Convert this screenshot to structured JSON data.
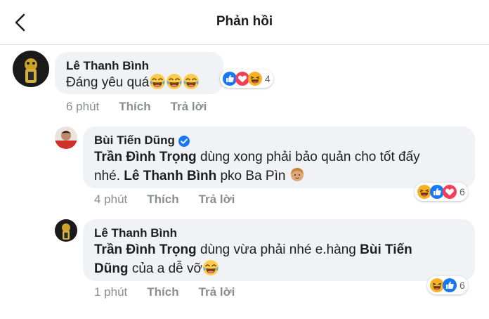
{
  "header": {
    "title": "Phản hồi"
  },
  "comments": [
    {
      "author": "Lê Thanh Bình",
      "text": "Đáng yêu quá",
      "time": "6 phút",
      "like_label": "Thích",
      "reply_label": "Trả lời",
      "reaction_count": "4",
      "reactions": [
        "like-icon",
        "love-icon",
        "haha-icon"
      ],
      "inline_emoji": [
        "laughing-emoji-icon",
        "laughing-emoji-icon",
        "laughing-emoji-icon"
      ]
    },
    {
      "author": "Bùi Tiến Dũng",
      "verified": true,
      "mention1": "Trần Đình Trọng",
      "text_part1": " dùng xong phải bảo quản cho tốt đấy",
      "text_part2": "nhé. ",
      "mention2": "Lê Thanh Bình",
      "text_part3": " pko Ba Pìn",
      "time": "4 phút",
      "like_label": "Thích",
      "reply_label": "Trả lời",
      "reaction_count": "6",
      "reactions": [
        "haha-icon",
        "like-icon",
        "love-icon"
      ],
      "inline_emoji": [
        "person-emoji-icon"
      ]
    },
    {
      "author": "Lê Thanh Bình",
      "mention1": "Trần Đình Trọng",
      "text_part1": " dùng vừa phải nhé e.hàng ",
      "mention2": "Bùi Tiến",
      "mention2b": "Dũng",
      "text_part2": " của a dễ vỡ",
      "time": "1 phút",
      "like_label": "Thích",
      "reply_label": "Trả lời",
      "reaction_count": "6",
      "reactions": [
        "haha-icon",
        "like-icon"
      ],
      "inline_emoji": [
        "laughing-emoji-icon"
      ]
    }
  ],
  "colors": {
    "accent": "#1877f2",
    "love": "#f33e58",
    "haha": "#f7b125",
    "bubble": "#f0f2f5",
    "meta": "#8a8d91"
  }
}
